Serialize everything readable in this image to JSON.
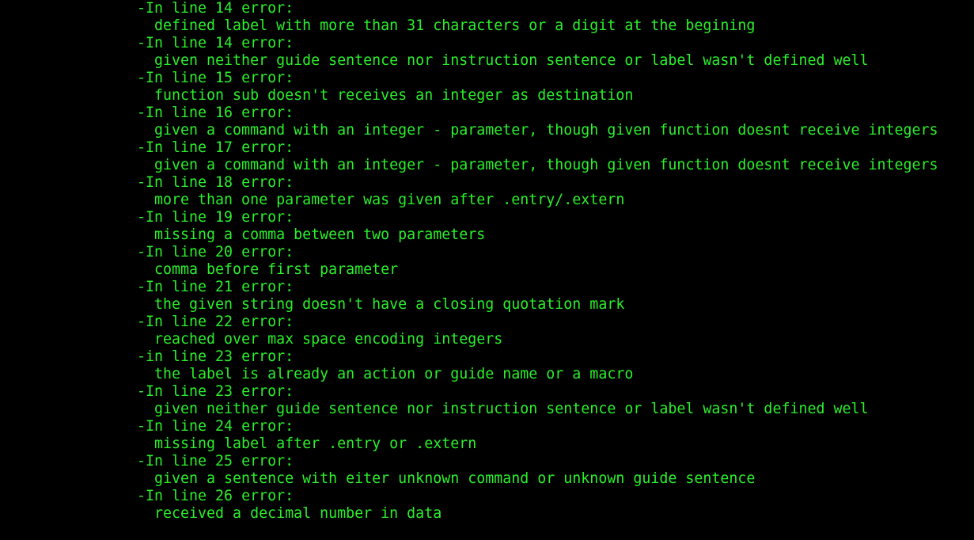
{
  "terminal": {
    "text_color": "#2bf02b",
    "background": "#000000",
    "errors": [
      {
        "header": "-In line 14 error:",
        "message": "defined label with more than 31 characters or a digit at the begining"
      },
      {
        "header": "-In line 14 error:",
        "message": "given neither guide sentence nor instruction sentence or label wasn't defined well"
      },
      {
        "header": "-In line 15 error:",
        "message": "function sub doesn't receives an integer as destination"
      },
      {
        "header": "-In line 16 error:",
        "message": "given a command with an integer - parameter, though given function doesnt receive integers"
      },
      {
        "header": "-In line 17 error:",
        "message": "given a command with an integer - parameter, though given function doesnt receive integers"
      },
      {
        "header": "-In line 18 error:",
        "message": "more than one parameter was given after .entry/.extern"
      },
      {
        "header": "-In line 19 error:",
        "message": "missing a comma between two parameters"
      },
      {
        "header": "-In line 20 error:",
        "message": "comma before first parameter"
      },
      {
        "header": "-In line 21 error:",
        "message": "the given string doesn't have a closing quotation mark"
      },
      {
        "header": "-In line 22 error:",
        "message": "reached over max space encoding integers"
      },
      {
        "header": "-in line 23 error:",
        "message": "the label is already an action or guide name or a macro"
      },
      {
        "header": "-In line 23 error:",
        "message": "given neither guide sentence nor instruction sentence or label wasn't defined well"
      },
      {
        "header": "-In line 24 error:",
        "message": "missing label after .entry or .extern"
      },
      {
        "header": "-In line 25 error:",
        "message": "given a sentence with eiter unknown command or unknown guide sentence"
      },
      {
        "header": "-In line 26 error:",
        "message": "received a decimal number in data"
      }
    ]
  }
}
